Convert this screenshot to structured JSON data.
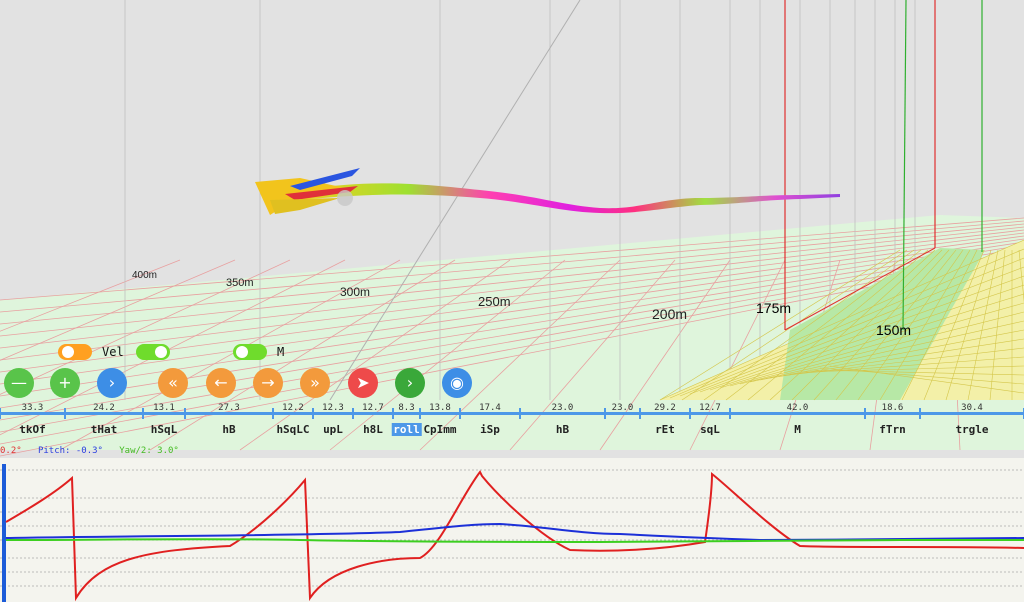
{
  "scene": {
    "distance_labels": [
      "400m",
      "350m",
      "300m",
      "250m",
      "200m",
      "175m",
      "150m"
    ]
  },
  "toggles": [
    {
      "label": "",
      "on": true,
      "color": "#ffa020"
    },
    {
      "label": "Vel",
      "on": true,
      "color": "#6fdc2c"
    },
    {
      "label": "M",
      "on": false,
      "color": "#6fdc2c"
    }
  ],
  "toolbar": {
    "buttons": [
      {
        "icon": "minus-icon",
        "glyph": "—",
        "color": "#59c44a"
      },
      {
        "icon": "plus-icon",
        "glyph": "+",
        "color": "#59c44a"
      },
      {
        "icon": "chevron-right-icon",
        "glyph": "›",
        "color": "#3d8ee6"
      },
      {
        "icon": "double-chevron-left-icon",
        "glyph": "«",
        "color": "#f39a3c"
      },
      {
        "icon": "arrow-left-icon",
        "glyph": "←",
        "color": "#f39a3c"
      },
      {
        "icon": "arrow-right-icon",
        "glyph": "→",
        "color": "#f39a3c"
      },
      {
        "icon": "double-chevron-right-icon",
        "glyph": "»",
        "color": "#f39a3c"
      },
      {
        "icon": "paper-plane-icon",
        "glyph": "➤",
        "color": "#ee4a4a"
      },
      {
        "icon": "chevron-right-circle-icon",
        "glyph": "›",
        "color": "#3aa83a"
      },
      {
        "icon": "eye-icon",
        "glyph": "◉",
        "color": "#3d8ee6"
      }
    ]
  },
  "timeline": {
    "segments": [
      {
        "value": "33.3",
        "label": "tkOf"
      },
      {
        "value": "24.2",
        "label": "tHat"
      },
      {
        "value": "13.1",
        "label": "hSqL"
      },
      {
        "value": "27.3",
        "label": "hB"
      },
      {
        "value": "12.2",
        "label": "hSqLC"
      },
      {
        "value": "12.3",
        "label": "upL"
      },
      {
        "value": "12.7",
        "label": "h8L"
      },
      {
        "value": "8.3",
        "label": "roll",
        "selected": true
      },
      {
        "value": "13.8",
        "label": "CpImm"
      },
      {
        "value": "17.4",
        "label": "iSp"
      },
      {
        "value": "23.0",
        "label": "hB"
      },
      {
        "value": "23.0",
        "label": ""
      },
      {
        "value": "29.2",
        "label": "rEt"
      },
      {
        "value": "12.7",
        "label": "sqL"
      },
      {
        "value": "42.0",
        "label": "M"
      },
      {
        "value": "18.6",
        "label": "fTrn"
      },
      {
        "value": "30.4",
        "label": "trgle"
      }
    ]
  },
  "readout": {
    "roll_text": "0.2°",
    "pitch_text": "Pitch: -0.3°",
    "yaw_text": "Yaw/2: 3.0°",
    "roll_color": "#e03030",
    "pitch_color": "#2a3ee0",
    "yaw_color": "#44bb22"
  },
  "colors": {
    "accent": "#4d98e8",
    "roll_line": "#e02020",
    "pitch_line": "#1c30d8",
    "yaw_line": "#3ccf20"
  }
}
